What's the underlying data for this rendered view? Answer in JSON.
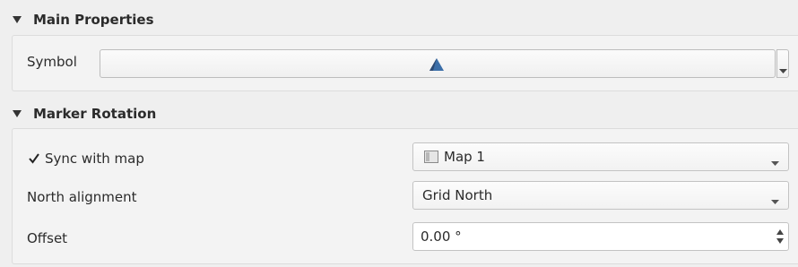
{
  "main_properties": {
    "title": "Main Properties",
    "symbol_label": "Symbol"
  },
  "marker_rotation": {
    "title": "Marker Rotation",
    "sync_label": "Sync with map",
    "sync_checked": true,
    "map_value": "Map 1",
    "north_label": "North alignment",
    "north_value": "Grid North",
    "offset_label": "Offset",
    "offset_value": "0.00 °"
  },
  "icons": {
    "expand": "triangle-down-icon",
    "symbol_preview": "north-arrow-marker-icon",
    "map_icon": "map-canvas-icon",
    "dropdown": "chevron-down-icon",
    "spinner": "up-down-spinner-icon"
  },
  "colors": {
    "accent_blue": "#3b6ea8",
    "marker_dark": "#2d4a73"
  }
}
